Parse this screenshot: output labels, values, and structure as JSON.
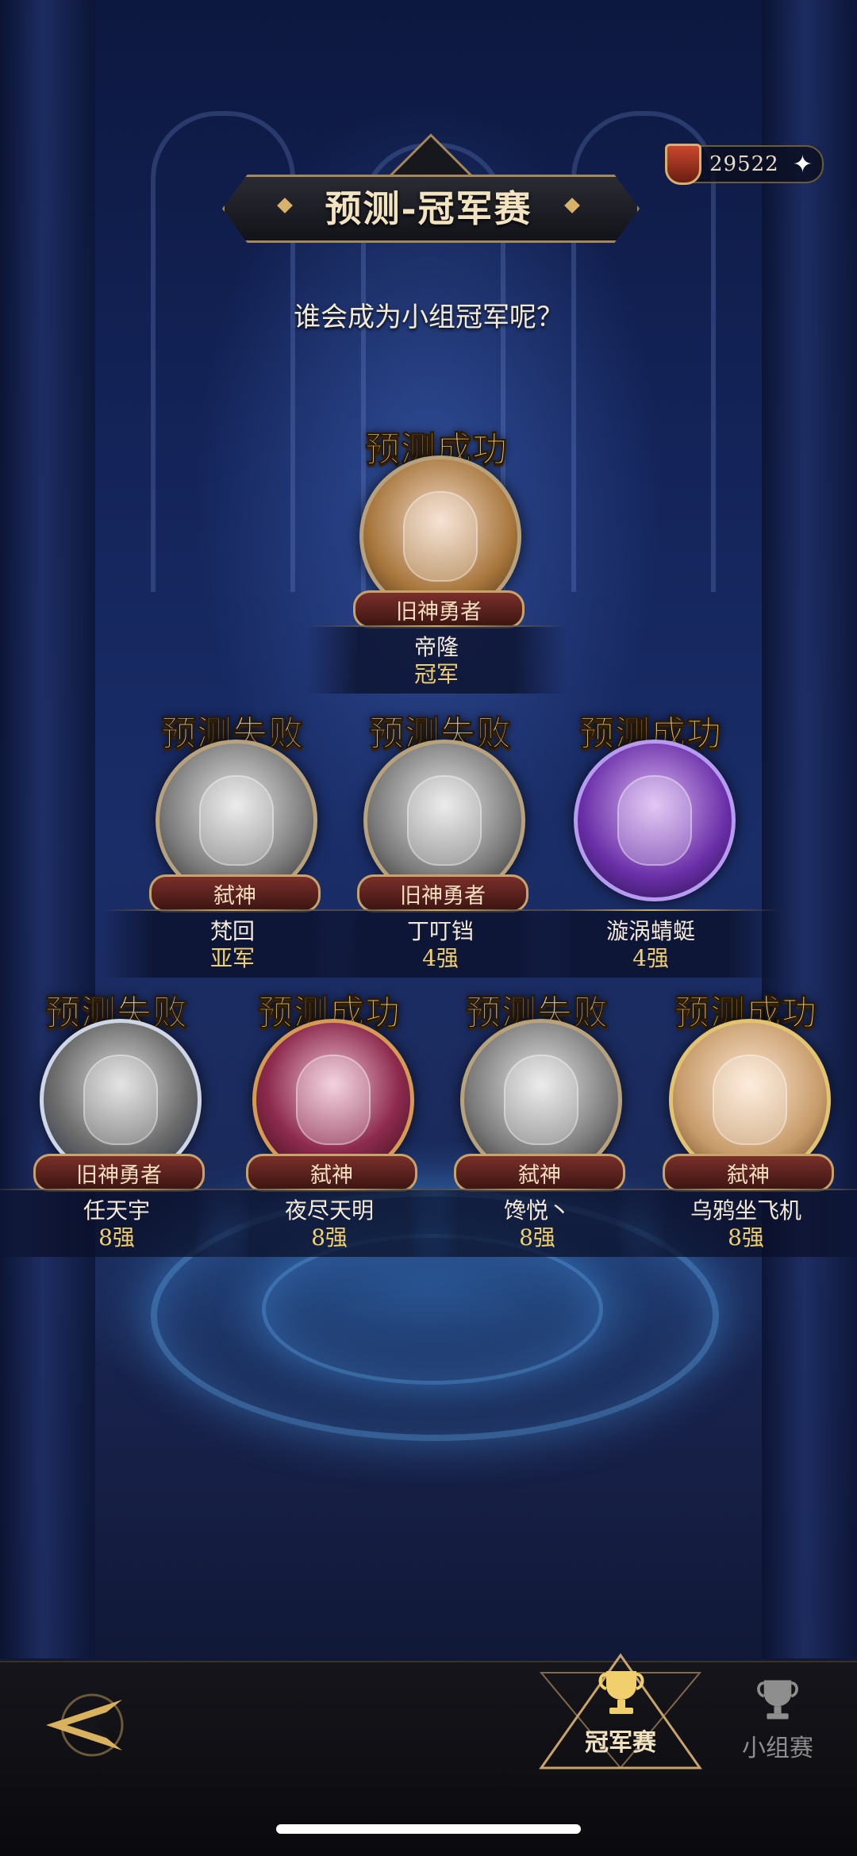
{
  "currency": {
    "amount": "29522",
    "plus": "✦",
    "icon": "shield-icon"
  },
  "header": {
    "title": "预测-冠军赛",
    "subtitle": "谁会成为小组冠军呢？"
  },
  "champion": {
    "result": "预测成功",
    "faction": "旧神勇者",
    "name": "帝隆",
    "rank": "冠军"
  },
  "semifinal": [
    {
      "result": "预测失败",
      "faction": "弑神",
      "name": "梵回",
      "rank": "亚军"
    },
    {
      "result": "预测失败",
      "faction": "旧神勇者",
      "name": "丁叮铛",
      "rank": "4强"
    },
    {
      "result": "预测成功",
      "faction": "",
      "name": "漩涡蜻蜓",
      "rank": "4强"
    }
  ],
  "quarterfinal": [
    {
      "result": "预测失败",
      "faction": "旧神勇者",
      "name": "任天宇",
      "rank": "8强"
    },
    {
      "result": "预测成功",
      "faction": "弑神",
      "name": "夜尽天明",
      "rank": "8强"
    },
    {
      "result": "预测失败",
      "faction": "弑神",
      "name": "馋悦丶",
      "rank": "8强"
    },
    {
      "result": "预测成功",
      "faction": "弑神",
      "name": "乌鸦坐飞机",
      "rank": "8强"
    }
  ],
  "bottom": {
    "champion_tab": "冠军赛",
    "group_tab": "小组赛"
  },
  "colors": {
    "success": "#f2d37a",
    "fail": "#d9d9d9",
    "rank": "#f2cf6d",
    "frame": "#c8a46a"
  }
}
